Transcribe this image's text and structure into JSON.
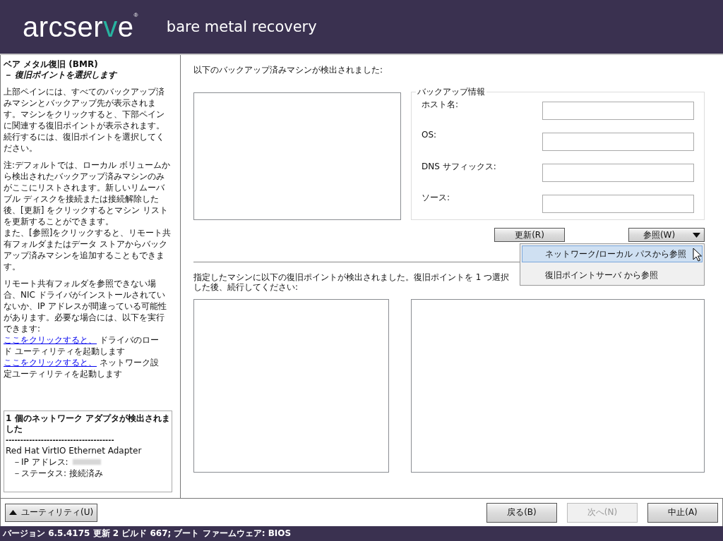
{
  "header": {
    "logo": [
      {
        "text": "arcser",
        "accent": false
      },
      {
        "text": "v",
        "accent": true
      },
      {
        "text": "e",
        "accent": false
      }
    ],
    "registered": "®",
    "product": "bare metal recovery"
  },
  "sidebar": {
    "title": "ベア メタル復旧 (BMR)",
    "subtitle": "－ 復旧ポイントを選択します",
    "paragraphs": [
      {
        "lines": [
          {
            "kind": "text",
            "text": "上部ペインには、すべてのバックアップ済みマシンとバックアップ先が表示されます。マシンをクリックすると、下部ペインに関連する復旧ポイントが表示されます。続行するには、復旧ポイントを選択してください。"
          }
        ]
      },
      {
        "lines": [
          {
            "kind": "text",
            "text": "注:デフォルトでは、ローカル ボリュームから検出されたバックアップ済みマシンのみがここにリストされます。新しいリムーバブル ディスクを接続または接続解除した後、[更新] をクリックするとマシン リストを更新することができます。"
          },
          {
            "kind": "text",
            "text": "また、[参照]をクリックすると、リモート共有フォルダまたはデータ ストアからバックアップ済みマシンを追加することもできます。"
          }
        ]
      },
      {
        "lines": [
          {
            "kind": "text",
            "text": "リモート共有フォルダを参照できない場合、NIC ドライバがインストールされていないか、IP アドレスが間違っている可能性があります。必要な場合には、以下を実行できます:"
          },
          {
            "kind": "link",
            "link": "ここをクリックすると、",
            "text": "ドライバのロード ユーティリティを起動します"
          },
          {
            "kind": "link",
            "link": "ここをクリックすると、",
            "text": "ネットワーク設定ユーティリティを起動します"
          }
        ]
      }
    ],
    "network": {
      "title": "1 個のネットワーク アダプタが検出されました",
      "rule": "-------------------------------------",
      "adapter": "Red Hat VirtIO Ethernet Adapter",
      "ip_label": "－IP アドレス:",
      "ip_redacted": true,
      "status": "－ステータス: 接続済み"
    }
  },
  "machines": {
    "label": "以下のバックアップ済みマシンが検出されました:"
  },
  "backup_info": {
    "legend": "バックアップ情報",
    "fields": [
      {
        "label": "ホスト名:"
      },
      {
        "label": "OS:"
      },
      {
        "label": "DNS サフィックス:"
      },
      {
        "label": "ソース:"
      }
    ]
  },
  "refresh_button": "更新(R)",
  "browse_button": "参照(W)",
  "browse_menu": [
    {
      "label": "ネットワーク/ローカル パスから参照",
      "selected": true
    },
    {
      "label": "復旧ポイントサーバ から参照",
      "selected": false
    }
  ],
  "recovery_points": {
    "label": "指定したマシンに以下の復旧ポイントが検出されました。復旧ポイントを 1 つ選択した後、続行してください:"
  },
  "utility_button": "ユーティリティ(U)",
  "nav_buttons": [
    {
      "label": "戻る(B)",
      "disabled": false
    },
    {
      "label": "次へ(N)",
      "disabled": true
    },
    {
      "label": "中止(A)",
      "disabled": false
    }
  ],
  "status_bar": "バージョン 6.5.4175 更新 2 ビルド 667; ブート ファームウェア: BIOS"
}
